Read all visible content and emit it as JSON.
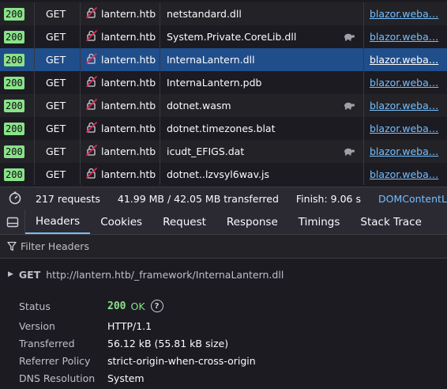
{
  "requests": [
    {
      "status": "200",
      "method": "GET",
      "domain": "lantern.htb",
      "file": "netstandard.dll",
      "initiator": "blazor.weba…",
      "throttled": false,
      "selected": false
    },
    {
      "status": "200",
      "method": "GET",
      "domain": "lantern.htb",
      "file": "System.Private.CoreLib.dll",
      "initiator": "blazor.weba…",
      "throttled": true,
      "selected": false
    },
    {
      "status": "200",
      "method": "GET",
      "domain": "lantern.htb",
      "file": "InternaLantern.dll",
      "initiator": "blazor.weba…",
      "throttled": false,
      "selected": true
    },
    {
      "status": "200",
      "method": "GET",
      "domain": "lantern.htb",
      "file": "InternaLantern.pdb",
      "initiator": "blazor.weba…",
      "throttled": false,
      "selected": false
    },
    {
      "status": "200",
      "method": "GET",
      "domain": "lantern.htb",
      "file": "dotnet.wasm",
      "initiator": "blazor.weba…",
      "throttled": true,
      "selected": false
    },
    {
      "status": "200",
      "method": "GET",
      "domain": "lantern.htb",
      "file": "dotnet.timezones.blat",
      "initiator": "blazor.weba…",
      "throttled": false,
      "selected": false
    },
    {
      "status": "200",
      "method": "GET",
      "domain": "lantern.htb",
      "file": "icudt_EFIGS.dat",
      "initiator": "blazor.weba…",
      "throttled": true,
      "selected": false
    },
    {
      "status": "200",
      "method": "GET",
      "domain": "lantern.htb",
      "file": "dotnet..lzvsyl6wav.js",
      "initiator": "blazor.weba…",
      "throttled": false,
      "selected": false
    }
  ],
  "summary": {
    "requests": "217 requests",
    "transferred": "41.99 MB / 42.05 MB transferred",
    "finish": "Finish: 9.06 s",
    "dom_content_loaded": "DOMContentLo"
  },
  "tabs": [
    {
      "label": "Headers",
      "active": true
    },
    {
      "label": "Cookies",
      "active": false
    },
    {
      "label": "Request",
      "active": false
    },
    {
      "label": "Response",
      "active": false
    },
    {
      "label": "Timings",
      "active": false
    },
    {
      "label": "Stack Trace",
      "active": false
    }
  ],
  "filter": {
    "placeholder": "Filter Headers"
  },
  "request_line": {
    "method": "GET",
    "url": "http://lantern.htb/_framework/InternaLantern.dll"
  },
  "details": {
    "status_label": "Status",
    "status_code": "200",
    "status_text": "OK",
    "version_label": "Version",
    "version_value": "HTTP/1.1",
    "transferred_label": "Transferred",
    "transferred_value": "56.12 kB (55.81 kB size)",
    "referrer_label": "Referrer Policy",
    "referrer_value": "strict-origin-when-cross-origin",
    "dns_label": "DNS Resolution",
    "dns_value": "System"
  },
  "colors": {
    "status_ok": "#8ae28a",
    "link": "#75bfff",
    "selected_row": "#204e8a"
  }
}
